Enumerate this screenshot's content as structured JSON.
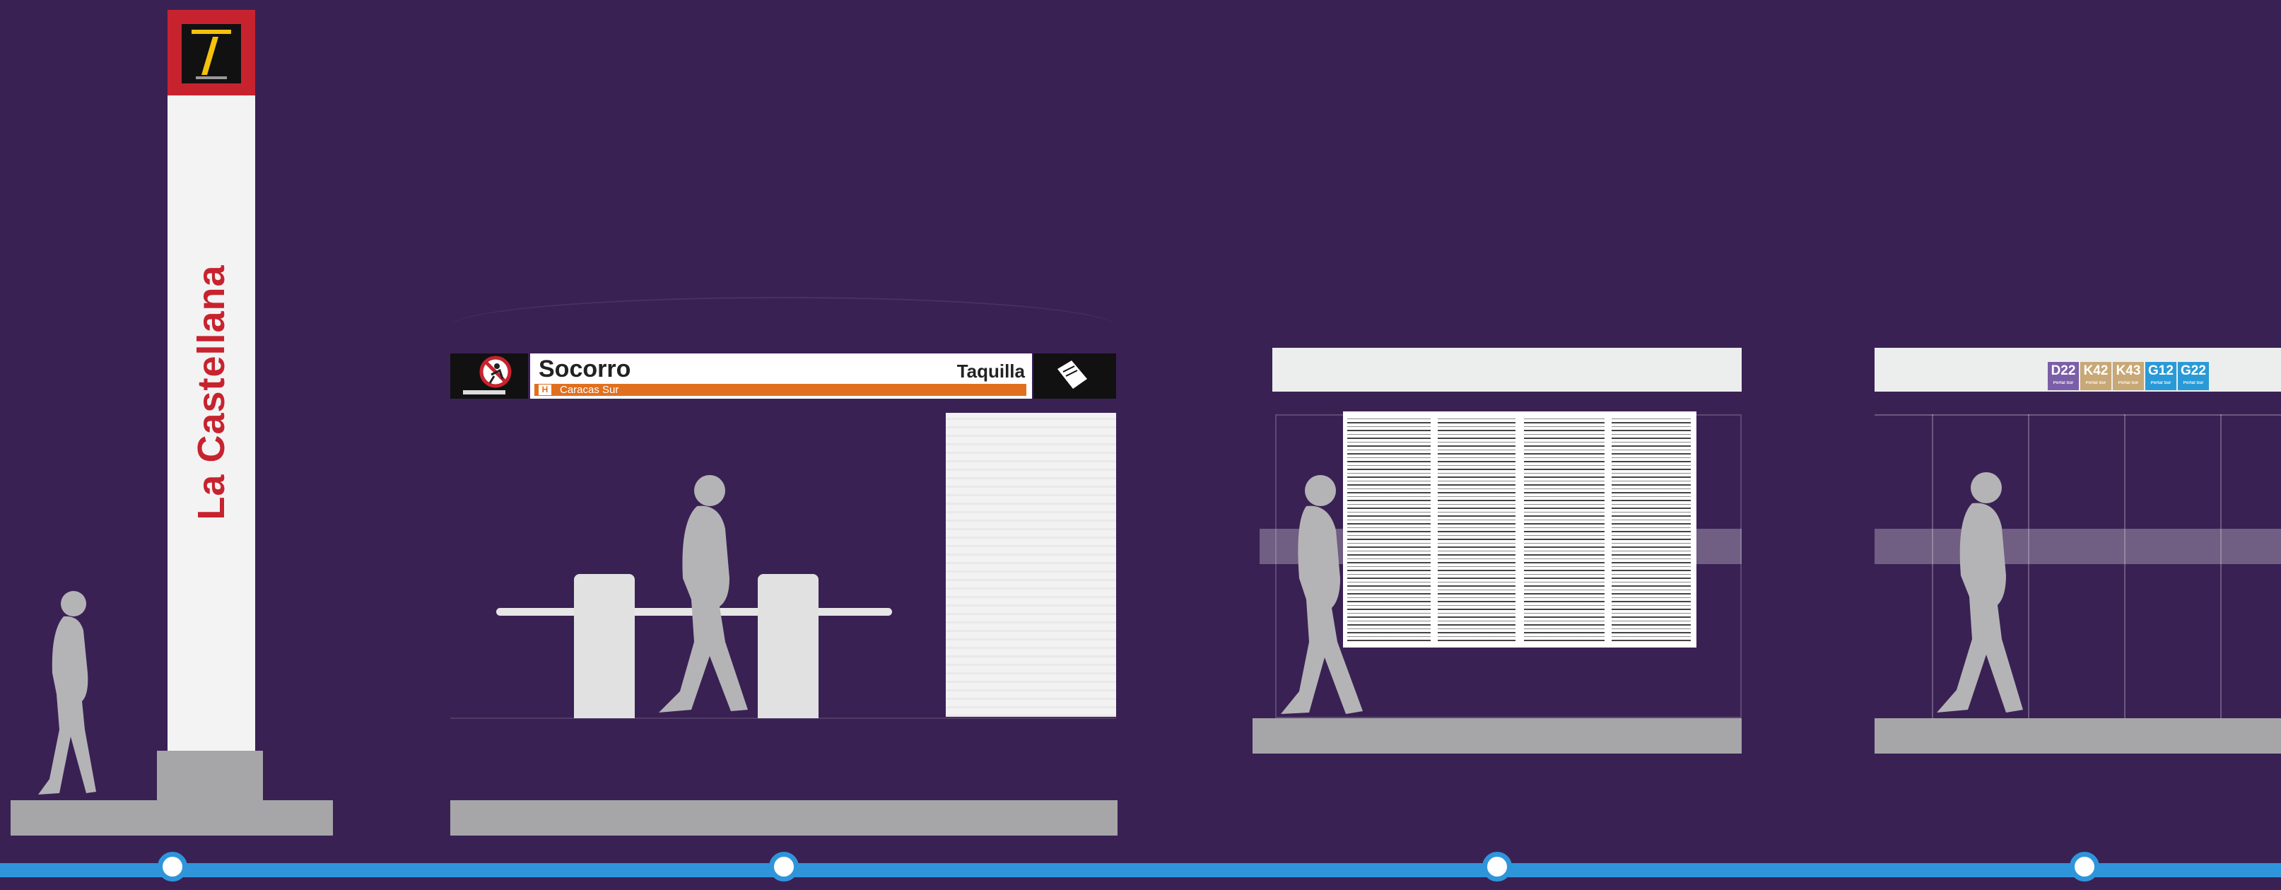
{
  "stations": [
    {
      "name": "La Castellana"
    },
    {
      "name": "Socorro",
      "service": "Taquilla",
      "line_badge": "H",
      "line_destination": "Caracas Sur"
    },
    {
      "name": ""
    },
    {
      "routes": [
        {
          "code": "D22",
          "sub": "Portal Sur",
          "color": "#7b5ea8"
        },
        {
          "code": "K42",
          "sub": "Portal Sur",
          "color": "#c8a876"
        },
        {
          "code": "K43",
          "sub": "Portal Sur",
          "color": "#c8a876"
        },
        {
          "code": "G12",
          "sub": "Portal Sur",
          "color": "#2a9ad7"
        },
        {
          "code": "G22",
          "sub": "Portal Sur",
          "color": "#2a9ad7"
        }
      ]
    }
  ],
  "colors": {
    "background": "#3a2154",
    "brand_red": "#c7232e",
    "line_orange": "#e0701f",
    "timeline_blue": "#2f95db",
    "silhouette_grey": "#b4b4b6"
  },
  "icons": [
    "transmilenio-logo-icon",
    "no-running-icon",
    "ticket-icon"
  ]
}
